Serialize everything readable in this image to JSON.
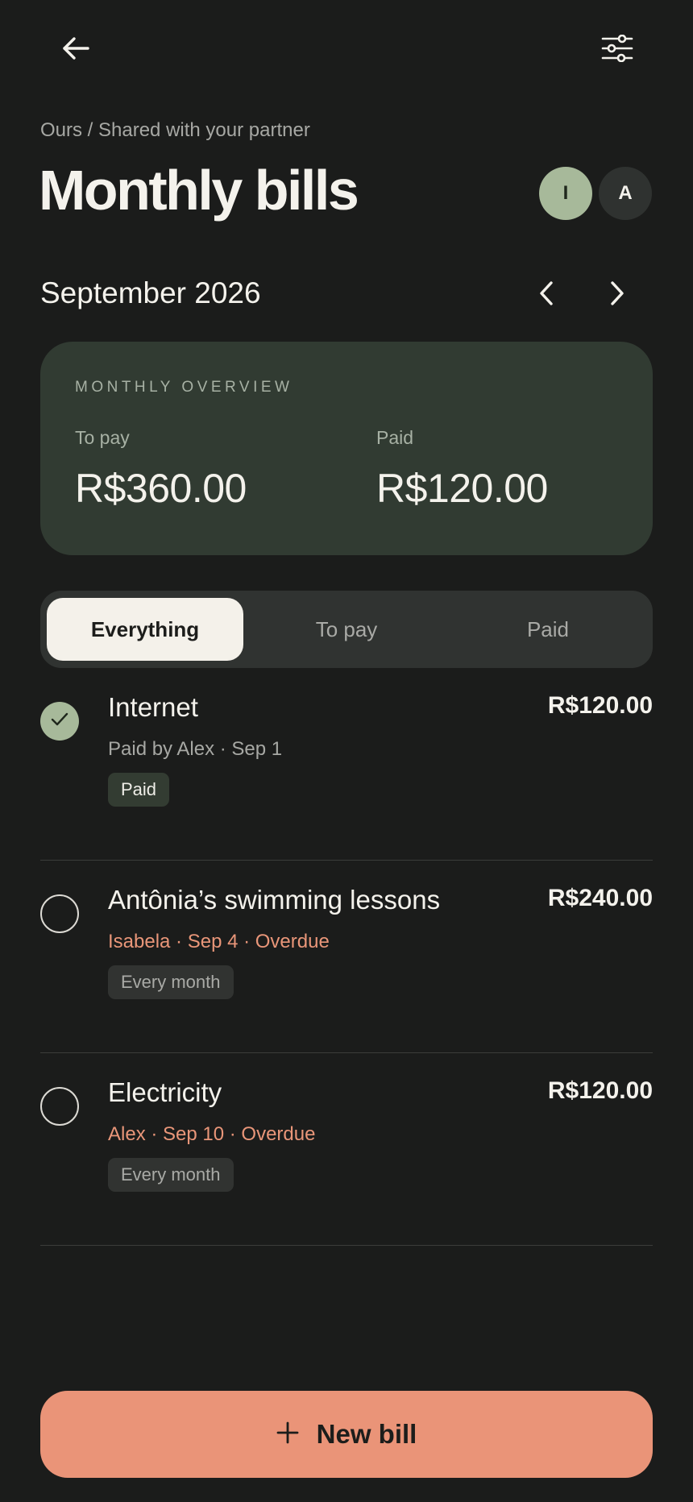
{
  "header": {
    "breadcrumb": "Ours / Shared with your partner",
    "title": "Monthly bills",
    "avatars": [
      "I",
      "A"
    ]
  },
  "period": {
    "label": "September 2026"
  },
  "overview": {
    "heading": "MONTHLY OVERVIEW",
    "to_pay_label": "To pay",
    "to_pay_value": "R$360.00",
    "paid_label": "Paid",
    "paid_value": "R$120.00"
  },
  "filters": {
    "tabs": [
      "Everything",
      "To pay",
      "Paid"
    ],
    "selected": "Everything"
  },
  "bills": [
    {
      "name": "Internet",
      "amount": "R$120.00",
      "meta": "Paid by Alex · Sep 1",
      "tag": "Paid",
      "status": "paid"
    },
    {
      "name": "Antônia’s swimming lessons",
      "amount": "R$240.00",
      "meta": "Isabela · Sep 4 · Overdue",
      "tag": "Every month",
      "status": "overdue"
    },
    {
      "name": "Electricity",
      "amount": "R$120.00",
      "meta": "Alex · Sep 10 · Overdue",
      "tag": "Every month",
      "status": "overdue"
    }
  ],
  "actions": {
    "new_bill": "New bill"
  },
  "icons": {
    "back": "arrow-left-icon",
    "filter": "sliders-icon",
    "prev": "chevron-left-icon",
    "next": "chevron-right-icon",
    "check": "check-icon",
    "add": "plus-icon"
  },
  "colors": {
    "background": "#1b1c1b",
    "overview_card": "#313b32",
    "accent_sage": "#a7b99a",
    "accent_coral": "#ea9478",
    "overdue_text": "#e99679"
  }
}
